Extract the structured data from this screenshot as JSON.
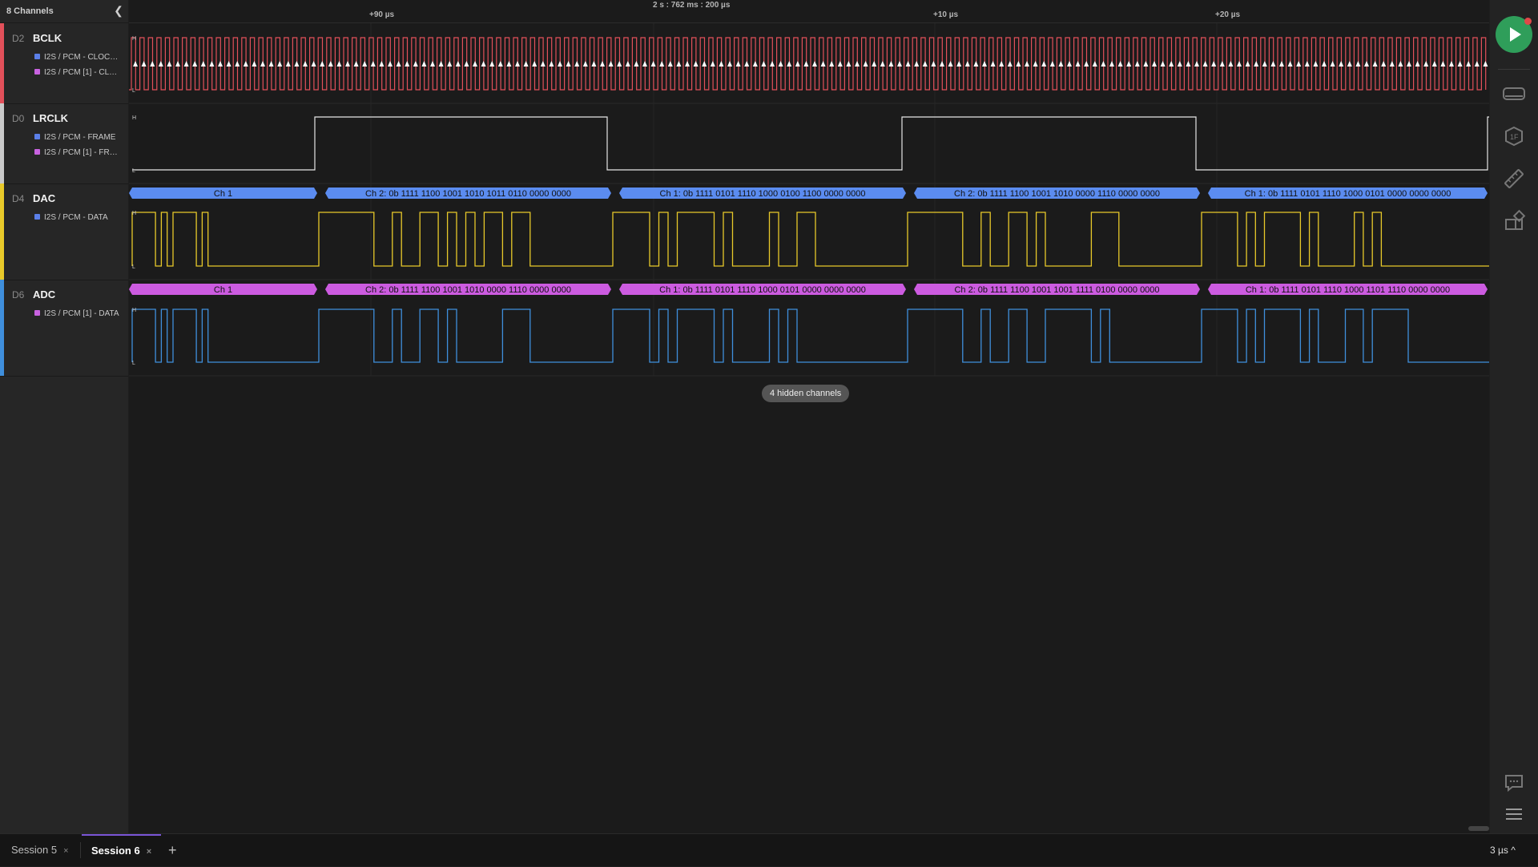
{
  "sidebar": {
    "channels_count": "8 Channels",
    "channels": [
      {
        "id": "D2",
        "name": "BCLK",
        "color": "#e2505a",
        "analyzers": [
          {
            "label": "I2S / PCM - CLOCK ...",
            "color": "#5b7fe8"
          },
          {
            "label": "I2S / PCM [1] - CLO...",
            "color": "#c862e0"
          }
        ]
      },
      {
        "id": "D0",
        "name": "LRCLK",
        "color": "#c9c9c9",
        "analyzers": [
          {
            "label": "I2S / PCM - FRAME",
            "color": "#5b7fe8"
          },
          {
            "label": "I2S / PCM [1] - FRA...",
            "color": "#c862e0"
          }
        ]
      },
      {
        "id": "D4",
        "name": "DAC",
        "color": "#e8c92a",
        "analyzers": [
          {
            "label": "I2S / PCM - DATA",
            "color": "#5b7fe8"
          }
        ]
      },
      {
        "id": "D6",
        "name": "ADC",
        "color": "#3f8fdc",
        "analyzers": [
          {
            "label": "I2S / PCM [1] - DATA",
            "color": "#c862e0"
          }
        ]
      }
    ]
  },
  "ruler": {
    "center_time": "2 s : 762 ms : 200 µs",
    "ticks": [
      "+90 µs",
      "+10 µs",
      "+20 µs"
    ]
  },
  "waveforms": {
    "level_high": "H",
    "level_low": "L",
    "dac_frames": [
      "Ch 1",
      "Ch 2: 0b 1111 1100 1001 1010 1011 0110 0000 0000",
      "Ch 1: 0b 1111 0101 1110 1000 0100 1100 0000 0000",
      "Ch 2: 0b 1111 1100 1001 1010 0000 1110 0000 0000",
      "Ch 1: 0b 1111 0101 1110 1000 0101 0000 0000 0000"
    ],
    "adc_frames": [
      "Ch 1",
      "Ch 2: 0b 1111 1100 1001 1010 0000 1110 0000 0000",
      "Ch 1: 0b 1111 0101 1110 1000 0101 0000 0000 0000",
      "Ch 2: 0b 1111 1100 1001 1001 1111 0100 0000 0000",
      "Ch 1: 0b 1111 0101 1110 1000 1101 1110 0000 0000"
    ],
    "dac_frame_color": "#5b8cf0",
    "adc_frame_color": "#cc5be0"
  },
  "hidden_channels": "4 hidden channels",
  "rail": {
    "icons": [
      "play-icon",
      "device-icon",
      "analyzer-icon",
      "ruler-icon",
      "extensions-icon",
      "comment-icon",
      "menu-icon"
    ]
  },
  "tabs": [
    {
      "label": "Session 5",
      "active": false
    },
    {
      "label": "Session 6",
      "active": true
    }
  ],
  "timescale": "3 µs ^"
}
